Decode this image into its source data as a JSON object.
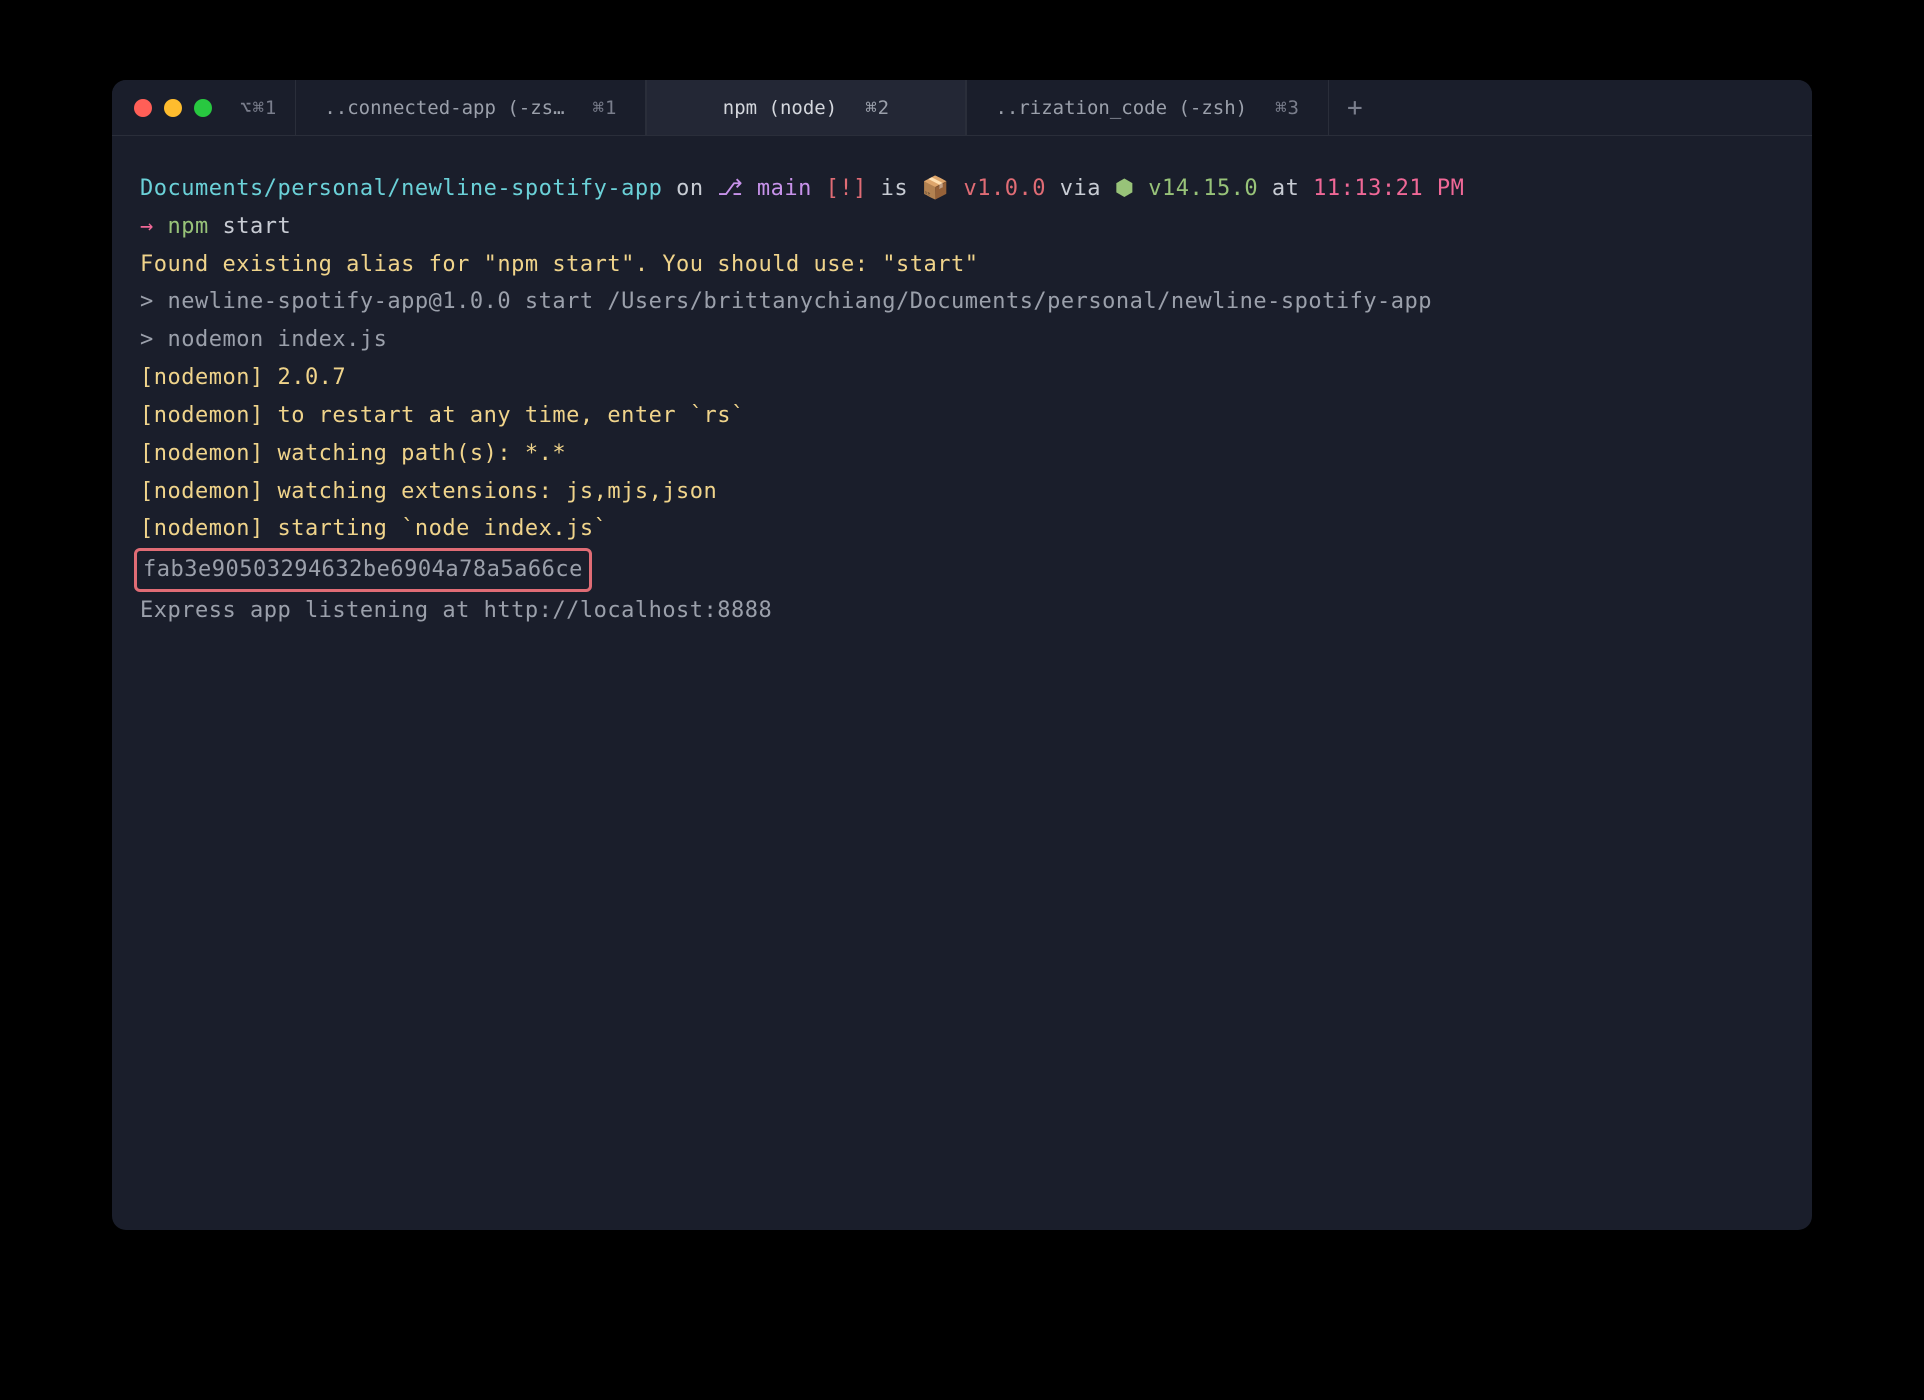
{
  "window": {
    "shortcut": "⌥⌘1"
  },
  "tabs": [
    {
      "title": "..connected-app (-zs…",
      "shortcut": "⌘1",
      "active": false
    },
    {
      "title": "npm (node)",
      "shortcut": "⌘2",
      "active": true
    },
    {
      "title": "..rization_code (-zsh)",
      "shortcut": "⌘3",
      "active": false
    }
  ],
  "new_tab_glyph": "+",
  "prompt": {
    "path": "Documents/personal/newline-spotify-app",
    "on": " on ",
    "branch_icon": "⎇",
    "branch": " main ",
    "git_status": "[!]",
    "is": " is ",
    "pkg_icon": "📦",
    "pkg_version": " v1.0.0",
    "via": " via ",
    "node_icon": "⬢",
    "node_version": " v14.15.0",
    "at": " at ",
    "time": "11:13:21 PM"
  },
  "cmd": {
    "arrow": "→ ",
    "bin": "npm",
    "args": " start"
  },
  "alias_line": "Found existing alias for \"npm start\". You should use: \"start\"",
  "blank": "",
  "run1": "> newline-spotify-app@1.0.0 start /Users/brittanychiang/Documents/personal/newline-spotify-app",
  "run2": "> nodemon index.js",
  "nodemon": [
    "[nodemon] 2.0.7",
    "[nodemon] to restart at any time, enter `rs`",
    "[nodemon] watching path(s): *.*",
    "[nodemon] watching extensions: js,mjs,json",
    "[nodemon] starting `node index.js`"
  ],
  "hash": "fab3e90503294632be6904a78a5a66ce",
  "listen": "Express app listening at http://localhost:8888"
}
